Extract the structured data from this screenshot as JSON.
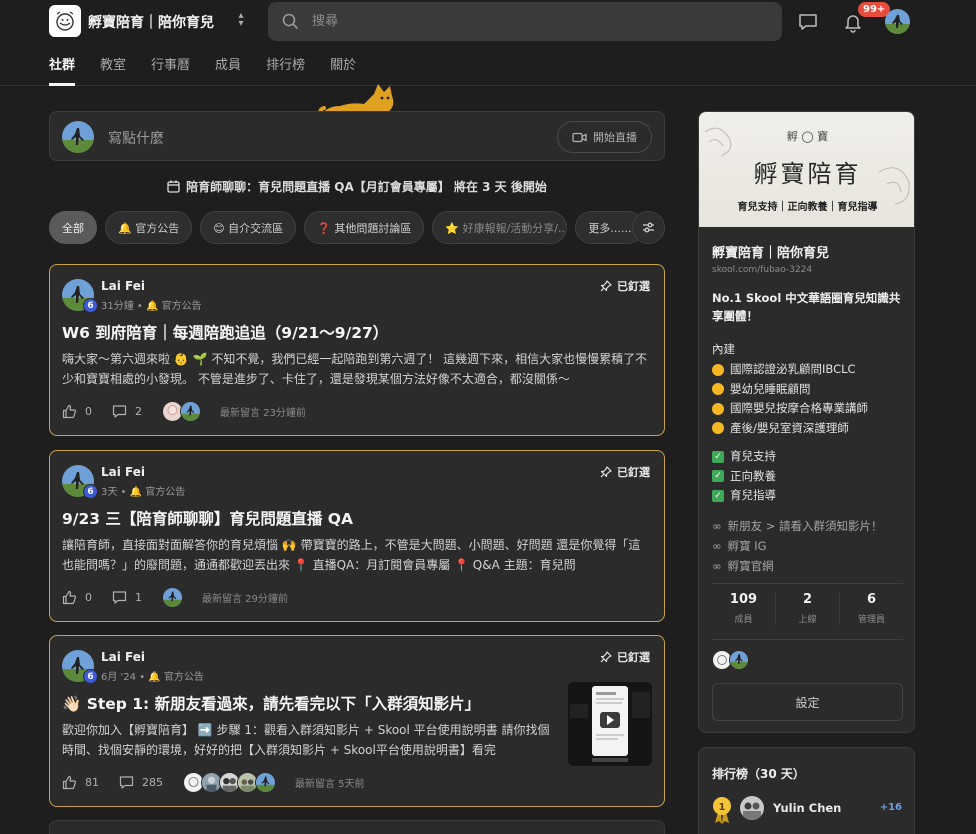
{
  "header": {
    "group_name": "孵寶陪育｜陪你育兒",
    "search_placeholder": "搜尋",
    "notification_count": "99+"
  },
  "tabs": [
    {
      "label": "社群",
      "active": true
    },
    {
      "label": "教室"
    },
    {
      "label": "行事曆"
    },
    {
      "label": "成員"
    },
    {
      "label": "排行榜"
    },
    {
      "label": "關於"
    }
  ],
  "composer": {
    "placeholder": "寫點什麼",
    "live_label": "開始直播"
  },
  "event_banner": "陪育師聊聊：育兒問題直播 QA【月訂會員專屬】 將在 3 天 後開始",
  "filters": [
    "全部",
    "🔔 官方公告",
    "😊 自介交流區",
    "❓ 其他問題討論區",
    "⭐ 好康報報/活動分享/...",
    "更多......"
  ],
  "posts": [
    {
      "author": "Lai Fei",
      "level": "6",
      "meta": "31分鐘 • 🔔 官方公告",
      "pinned_label": "已釘選",
      "title": "W6 到府陪育｜每週陪跑追追（9/21～9/27）",
      "body": "嗨大家～第六週來啦 👶 🌱 不知不覺，我們已經一起陪跑到第六週了！ 這幾週下來，相信大家也慢慢累積了不少和寶寶相處的小發現。 不管是進步了、卡住了，還是發現某個方法好像不太適合，都沒關係～",
      "likes": "0",
      "comments": "2",
      "latest": "最新留言 23分鐘前"
    },
    {
      "author": "Lai Fei",
      "level": "6",
      "meta": "3天 • 🔔 官方公告",
      "pinned_label": "已釘選",
      "title": "9/23 三【陪育師聊聊】育兒問題直播 QA",
      "body": "讓陪育師，直接面對面解答你的育兒煩惱 🙌 帶寶寶的路上，不管是大問題、小問題、好問題 還是你覺得「這也能問嗎？」的廢問題，通通都歡迎丟出來 📍 直播QA：月訂閱會員專屬 📍 Q&A 主題：育兒問",
      "likes": "0",
      "comments": "1",
      "latest": "最新留言 29分鐘前"
    },
    {
      "author": "Lai Fei",
      "level": "6",
      "meta": "6月 '24 • 🔔 官方公告",
      "pinned_label": "已釘選",
      "title": "👋🏻 Step 1: 新朋友看過來，請先看完以下「入群須知影片」",
      "body": "歡迎你加入【孵寶陪育】 ➡️ 步驟 1：觀看入群須知影片 + Skool 平台使用說明書 請你找個時間、找個安靜的環境，好好的把【入群須知影片 + Skool平台使用說明書】看完",
      "likes": "81",
      "comments": "285",
      "latest": "最新留言 5天前"
    }
  ],
  "sidebar": {
    "banner_small": "孵 ◯ 寶",
    "banner_title": "孵寶陪育",
    "banner_sub": "育兒支持｜正向教養｜育兒指導",
    "name": "孵寶陪育｜陪你育兒",
    "url": "skool.com/fubao-3224",
    "description": "No.1 Skool 中文華語圈育兒知識共享團體！",
    "inside_label": "內建",
    "experts": [
      "國際認證泌乳顧問IBCLC",
      "嬰幼兒睡眠顧問",
      "國際嬰兒按摩合格專業講師",
      "產後/嬰兒室資深護理師"
    ],
    "pillars": [
      "育兒支持",
      "正向教養",
      "育兒指導"
    ],
    "links": [
      "新朋友 > 請看入群須知影片！",
      "孵寶 IG",
      "孵寶官網"
    ],
    "stats": [
      {
        "value": "109",
        "label": "成員"
      },
      {
        "value": "2",
        "label": "上線"
      },
      {
        "value": "6",
        "label": "管理員"
      }
    ],
    "settings_label": "設定"
  },
  "leaderboard": {
    "title": "排行榜（30 天）",
    "rank": "1",
    "user": "Yulin Chen",
    "points": "+16"
  },
  "colors": {
    "accent_gold": "#c9a24a",
    "level_blue": "#3d5bd6",
    "badge_red": "#e74c3c"
  }
}
